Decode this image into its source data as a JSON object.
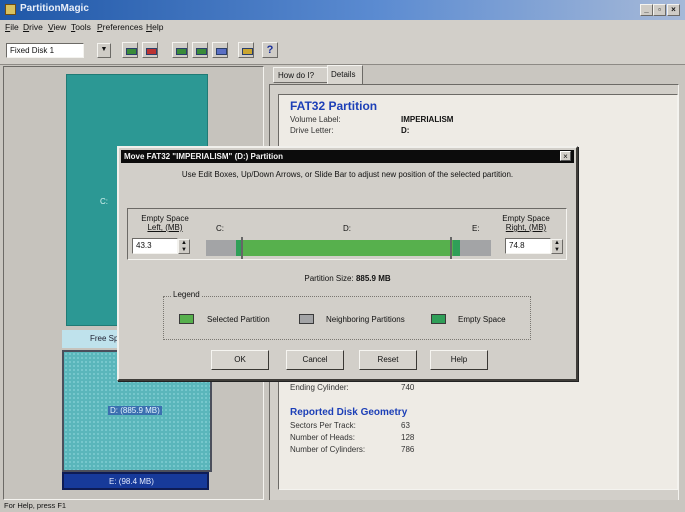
{
  "window": {
    "title": "PartitionMagic"
  },
  "menu": [
    "File",
    "Drive",
    "View",
    "Tools",
    "Preferences",
    "Help"
  ],
  "menu_underline": [
    "F",
    "D",
    "V",
    "T",
    "P",
    "H"
  ],
  "toolbar": {
    "disk_select": "Fixed Disk 1",
    "help_glyph": "?"
  },
  "map": {
    "c_label": "C:",
    "free_label": "Free Sp",
    "d_label": "D: (885.9 MB)",
    "e_label": "E: (98.4 MB)"
  },
  "tabs": {
    "howdo": "How do I?",
    "details": "Details"
  },
  "details": {
    "heading": "FAT32 Partition",
    "rows": [
      {
        "label": "Volume Label:",
        "value": "IMPERIALISM"
      },
      {
        "label": "Drive Letter:",
        "value": "D:"
      }
    ],
    "ending_cyl_label": "Ending Cylinder:",
    "ending_cyl_value": "740",
    "geometry_heading": "Reported Disk Geometry",
    "geometry": [
      {
        "label": "Sectors Per Track:",
        "value": "63"
      },
      {
        "label": "Number of Heads:",
        "value": "128"
      },
      {
        "label": "Number of Cylinders:",
        "value": "786"
      }
    ]
  },
  "status": "For Help, press F1",
  "dialog": {
    "title": "Move FAT32 \"IMPERIALISM\" (D:) Partition",
    "close": "×",
    "instructions": "Use Edit Boxes, Up/Down Arrows, or Slide Bar to adjust new position of the selected partition.",
    "left_label_1": "Empty Space",
    "left_label_2": "Left, (MB)",
    "left_value": "43.3",
    "right_label_1": "Empty Space",
    "right_label_2": "Right, (MB)",
    "right_value": "74.8",
    "bar_letters": {
      "c": "C:",
      "d": "D:",
      "e": "E:"
    },
    "size_label": "Partition Size:",
    "size_value": "885.9 MB",
    "legend_title": "Legend",
    "legend": [
      {
        "label": "Selected Partition",
        "color": "#57b04d"
      },
      {
        "label": "Neighboring Partitions",
        "color": "#a3a4a6"
      },
      {
        "label": "Empty Space",
        "color": "#2f9f58"
      }
    ],
    "buttons": {
      "ok": "OK",
      "cancel": "Cancel",
      "reset": "Reset",
      "help": "Help"
    }
  },
  "colors": {
    "title_bar": "#1f57a7",
    "partition_c": "#2c9894",
    "partition_e": "#173a9a",
    "dialog_title": "#0c0c0c"
  }
}
